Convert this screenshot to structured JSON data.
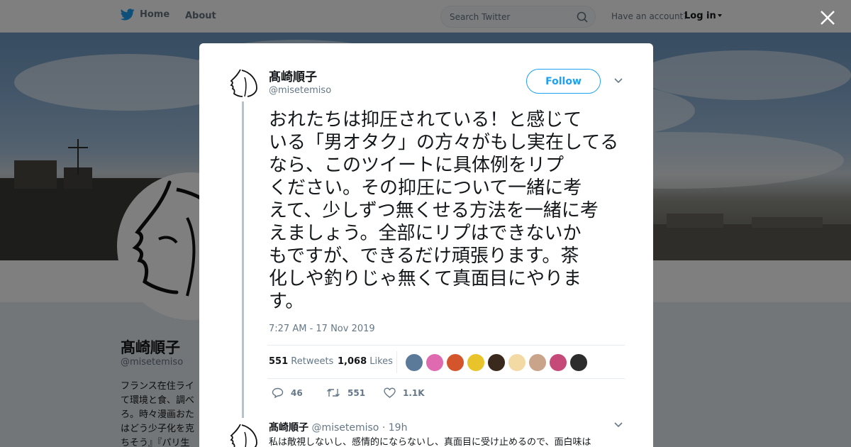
{
  "topbar": {
    "home_label": "Home",
    "about_label": "About",
    "search_placeholder": "Search Twitter",
    "have_account": "Have an account?",
    "login_label": "Log in"
  },
  "profile": {
    "name": "髙崎順子",
    "handle": "@misetemiso",
    "bio_lines": [
      "フランス在住ライ",
      "て環境と食、調べ",
      "ろ。時々漫画おた",
      "はどう少子化を克",
      "ちそう』『パリ生"
    ]
  },
  "tweet": {
    "author_name": "髙崎順子",
    "author_handle": "@misetemiso",
    "follow_label": "Follow",
    "text_lines": [
      "おれたちは抑圧されている！と感じて",
      "いる「男オタク」の方々がもし実在してる",
      "なら、このツイートに具体例をリプ",
      "ください。その抑圧について一緒に考",
      "えて、少しずつ無くせる方法を一緒に考",
      "えましょう。全部にリプはできないか",
      "もですが、できるだけ頑張ります。茶",
      "化しや釣りじゃ無くて真面目にやりま",
      "す。"
    ],
    "timestamp": "7:27 AM - 17 Nov 2019",
    "retweets_count": "551",
    "retweets_label": "Retweets",
    "likes_count": "1,068",
    "likes_label": "Likes",
    "actions": {
      "replies": "46",
      "retweets": "551",
      "likes": "1.1K"
    },
    "liker_avatar_colors": [
      "#5b7a99",
      "#e06ab0",
      "#d4552c",
      "#e8c42a",
      "#3a2a1e",
      "#f3d9a4",
      "#c9a38a",
      "#c54a7a",
      "#2c2c2c"
    ]
  },
  "reply": {
    "author_name": "髙崎順子",
    "author_handle": "@misetemiso",
    "separator": "·",
    "time": "19h",
    "text": "私は敵視しないし、感情的にならないし、真面目に受け止めるので、面白味は"
  },
  "colors": {
    "accent": "#1da1f2",
    "muted": "#657786",
    "thread_line": "#b2c5cd"
  }
}
